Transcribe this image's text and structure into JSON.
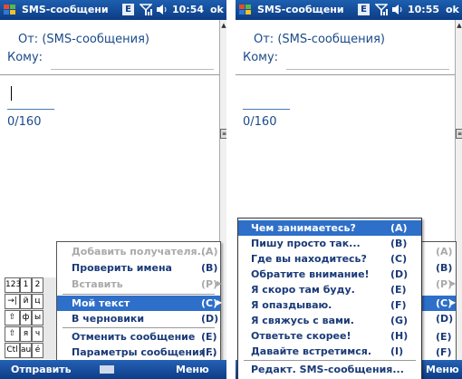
{
  "left": {
    "status": {
      "title": "SMS-сообщени",
      "kb": "E",
      "time": "10:54",
      "ok": "ok"
    },
    "from": "От: (SMS-сообщения)",
    "to": "Кому:",
    "counter": "0/160",
    "menu": [
      {
        "label": "Добавить получателя...",
        "key": "(A)",
        "disabled": true
      },
      {
        "label": "Проверить имена",
        "key": "(B)"
      },
      {
        "label": "Вставить",
        "key": "(P)",
        "disabled": true,
        "arrow": true
      },
      {
        "label": "Мой текст",
        "key": "(C)",
        "highlight": true,
        "arrow": true
      },
      {
        "label": "В черновики",
        "key": "(D)"
      },
      {
        "label": "Отменить сообщение",
        "key": "(E)"
      },
      {
        "label": "Параметры сообщения...",
        "key": "(F)"
      }
    ],
    "keys": [
      "123",
      "1",
      "2",
      "→|",
      "й",
      "ц",
      "⇧",
      "ф",
      "ы",
      "⇧",
      "я",
      "ч",
      "Ctl",
      "au",
      "é"
    ],
    "softkeys": {
      "left": "Отправить",
      "right": "Меню"
    }
  },
  "right": {
    "status": {
      "title": "SMS-сообщени",
      "kb": "E",
      "time": "10:55",
      "ok": "ok"
    },
    "from": "От: (SMS-сообщения)",
    "to": "Кому:",
    "counter": "0/160",
    "submenu": [
      {
        "label": "Чем занимаетесь?",
        "key": "(A)",
        "highlight": true
      },
      {
        "label": "Пишу просто так...",
        "key": "(B)"
      },
      {
        "label": "Где вы находитесь?",
        "key": "(C)"
      },
      {
        "label": "Обратите внимание!",
        "key": "(D)"
      },
      {
        "label": "Я скоро там буду.",
        "key": "(E)"
      },
      {
        "label": "Я опаздываю.",
        "key": "(F)"
      },
      {
        "label": "Я свяжусь с вами.",
        "key": "(G)"
      },
      {
        "label": "Ответьте скорее!",
        "key": "(H)"
      },
      {
        "label": "Давайте встретимся.",
        "key": "(I)"
      },
      {
        "label": "Редакт. SMS-сообщения...",
        "key": ""
      }
    ],
    "menu_partial": [
      {
        "key": "(A)",
        "disabled": true
      },
      {
        "key": "(B)"
      },
      {
        "key": "(P)",
        "disabled": true,
        "arrow": true
      },
      {
        "key": "(C)",
        "highlight": true,
        "arrow": true
      },
      {
        "key": "(D)"
      },
      {
        "key": "(E)"
      },
      {
        "key": "(F)"
      }
    ],
    "softkeys": {
      "right": "Меню"
    }
  }
}
